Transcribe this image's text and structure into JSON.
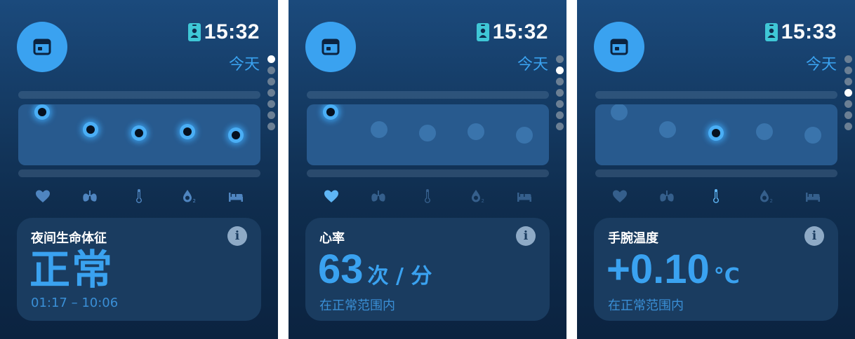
{
  "colors": {
    "accent": "#3aa2f0",
    "card": "#1a3c60",
    "band": "#285a8e",
    "dim_dot": "#3a74ac",
    "pager_inactive": "#6b7f94"
  },
  "screens": [
    {
      "app_icon": "calendar-window-icon",
      "status_icon": "badge-person-icon",
      "time": "15:32",
      "day_label": "今天",
      "active_page": 0,
      "page_count": 7,
      "highlighted_points": [
        0,
        1,
        2,
        3,
        4
      ],
      "active_metric": -1,
      "card": {
        "title": "夜间生命体征",
        "value": "正常",
        "unit": "",
        "sub": "01:17 – 10:06"
      }
    },
    {
      "app_icon": "calendar-window-icon",
      "status_icon": "badge-person-icon",
      "time": "15:32",
      "day_label": "今天",
      "active_page": 1,
      "page_count": 7,
      "highlighted_points": [
        0
      ],
      "active_metric": 0,
      "card": {
        "title": "心率",
        "value": "63",
        "unit": "次 / 分",
        "sub": "在正常范围内"
      }
    },
    {
      "app_icon": "calendar-window-icon",
      "status_icon": "badge-person-icon",
      "time": "15:33",
      "day_label": "今天",
      "active_page": 3,
      "page_count": 7,
      "highlighted_points": [
        2
      ],
      "active_metric": 2,
      "card": {
        "title": "手腕温度",
        "value": "+0.10",
        "unit": "°C",
        "sub": "在正常范围内"
      }
    }
  ],
  "metrics": [
    {
      "name": "heart-icon"
    },
    {
      "name": "lungs-icon"
    },
    {
      "name": "thermometer-icon"
    },
    {
      "name": "blood-oxygen-icon"
    },
    {
      "name": "bed-icon"
    }
  ]
}
